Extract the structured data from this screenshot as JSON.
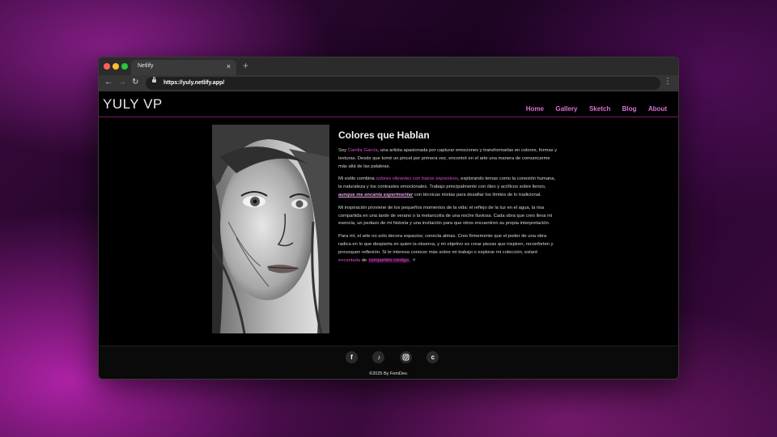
{
  "browser": {
    "tab_title": "Netlify",
    "tab_close": "×",
    "new_tab": "+",
    "url": "https://yuly.netlify.app/",
    "colors": {
      "close": "#ff5f57",
      "minimize": "#febc2e",
      "maximize": "#28c840"
    }
  },
  "site": {
    "logo": "YULY VP",
    "nav": [
      "Home",
      "Gallery",
      "Sketch",
      "Blog",
      "About"
    ],
    "accent": "#e050d0",
    "about": {
      "heading": "Colores que Hablan",
      "p1": {
        "a": "Soy ",
        "name": "Camila García",
        "b": ", una artista apasionada por capturar emociones y transformarlas en colores, formas y texturas. Desde que tomé un pincel por primera vez, encontré en el arte una manera de comunicarme más allá de las palabras."
      },
      "p2": {
        "a": "Mi estilo combina ",
        "h1": "colores vibrantes con trazos expresivos",
        "b": ", explorando temas como la conexión humana, la naturaleza y los contrastes emocionales. Trabajo principalmente con óleo y acrílicos sobre lienzo, ",
        "h2": "aunque me encanta experimentar",
        "c": " con técnicas mixtas para desafiar los límites de lo tradicional."
      },
      "p3": "Mi inspiración proviene de los pequeños momentos de la vida: el reflejo de la luz en el agua, la risa compartida en una tarde de verano o la melancolía de una noche lluviosa. Cada obra que creo lleva mi esencia, un pedazo de mi historia y una invitación para que otros encuentren su propia interpretación.",
      "p4": {
        "a": "Para mí, el arte no solo decora espacios; conecta almas. Creo firmemente que el poder de una obra radica en lo que despierta en quien la observa, y mi objetivo es crear piezas que inspiren, reconforten y provoquen reflexión. Si te interesa conocer más sobre mi trabajo o explorar mi colección, estaré ",
        "h1": "encantada",
        "b": " de ",
        "h2": "compartirlo contigo",
        "c": ". ✧"
      }
    },
    "footer": {
      "socials": [
        "facebook-icon",
        "tiktok-icon",
        "instagram-icon",
        "c-icon"
      ],
      "facebook": "f",
      "tiktok": "♪",
      "c": "c",
      "copyright": "©2025 By FemDev."
    }
  }
}
